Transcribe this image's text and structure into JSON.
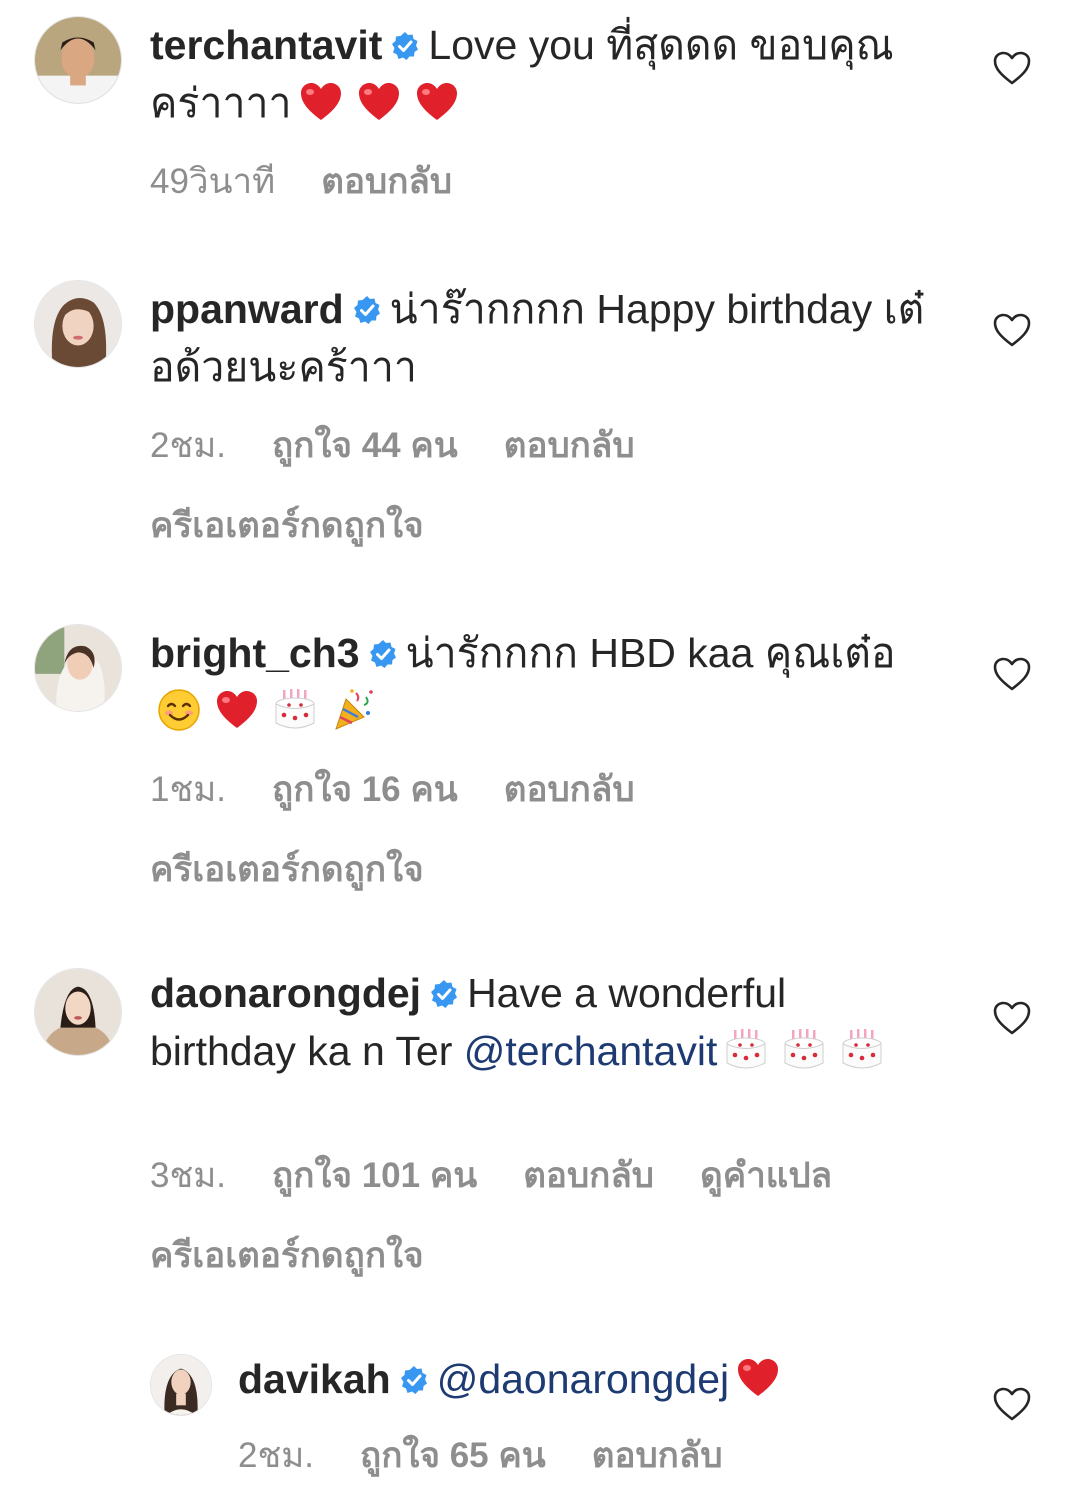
{
  "colors": {
    "text": "#262626",
    "muted": "#8e8e8e",
    "mention": "#1e3a73",
    "verified": "#3897f0",
    "heart": "#ed4956"
  },
  "comments": [
    {
      "username": "terchantavit",
      "text": "Love you ที่สุดดด ขอบคุณคร่าาาา",
      "emojis": [
        "red-heart",
        "red-heart",
        "red-heart"
      ],
      "time": "49วินาที",
      "likes": "",
      "reply_label": "ตอบกลับ",
      "creator_liked": ""
    },
    {
      "username": "ppanward",
      "text": "น่าร๊ากกกก Happy birthday เต๋อด้วยนะคร้าาา",
      "emojis": [],
      "time": "2ชม.",
      "likes": "ถูกใจ 44 คน",
      "reply_label": "ตอบกลับ",
      "creator_liked": "ครีเอเตอร์กดถูกใจ"
    },
    {
      "username": "bright_ch3",
      "text": "น่ารักกกก HBD kaa คุณเต๋อ",
      "emojis": [
        "smiling-face",
        "red-heart",
        "birthday-cake",
        "party-popper"
      ],
      "time": "1ชม.",
      "likes": "ถูกใจ 16 คน",
      "reply_label": "ตอบกลับ",
      "creator_liked": "ครีเอเตอร์กดถูกใจ"
    },
    {
      "username": "daonarongdej",
      "text": "Have a wonderful birthday ka n Ter",
      "mention": "@terchantavit",
      "emojis": [
        "birthday-cake",
        "birthday-cake",
        "birthday-cake"
      ],
      "time": "3ชม.",
      "likes": "ถูกใจ 101 คน",
      "reply_label": "ตอบกลับ",
      "translate_label": "ดูคำแปล",
      "creator_liked": "ครีเอเตอร์กดถูกใจ"
    },
    {
      "username": "davikah",
      "mention": "@daonarongdej",
      "emojis": [
        "red-heart"
      ],
      "time": "2ชม.",
      "likes": "ถูกใจ 65 คน",
      "reply_label": "ตอบกลับ"
    }
  ]
}
